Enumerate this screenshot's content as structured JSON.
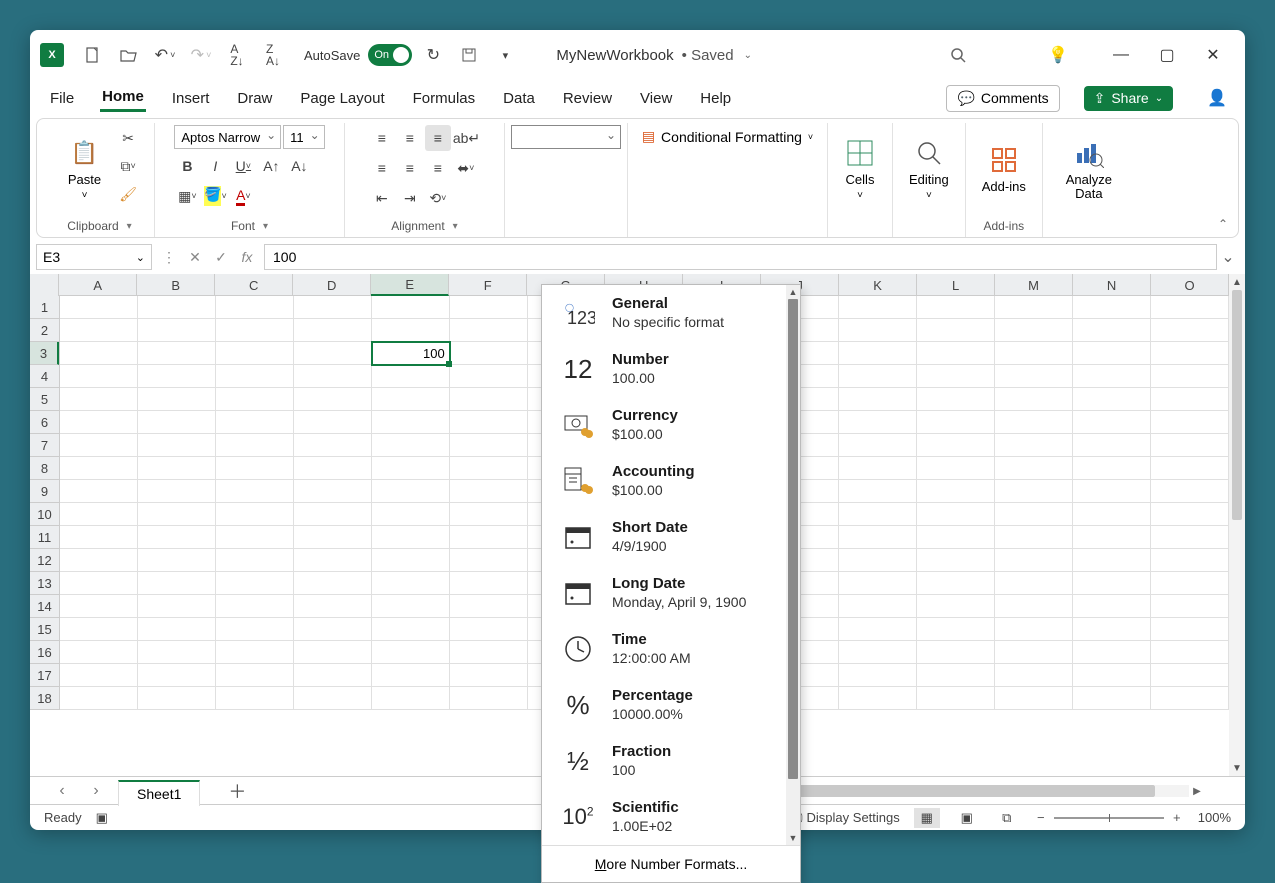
{
  "titlebar": {
    "autosave_label": "AutoSave",
    "autosave_state": "On",
    "filename": "MyNewWorkbook",
    "status": "Saved"
  },
  "tabs": {
    "file": "File",
    "home": "Home",
    "insert": "Insert",
    "draw": "Draw",
    "page_layout": "Page Layout",
    "formulas": "Formulas",
    "data": "Data",
    "review": "Review",
    "view": "View",
    "help": "Help",
    "comments": "Comments",
    "share": "Share"
  },
  "ribbon": {
    "clipboard": {
      "label": "Clipboard",
      "paste": "Paste"
    },
    "font": {
      "label": "Font",
      "name": "Aptos Narrow",
      "size": "11"
    },
    "alignment": {
      "label": "Alignment"
    },
    "conditional_formatting": "Conditional Formatting",
    "cells": "Cells",
    "editing": "Editing",
    "addins": "Add-ins",
    "addins_group": "Add-ins",
    "analyze_data": "Analyze Data"
  },
  "namebox": {
    "value": "E3"
  },
  "formula": {
    "value": "100"
  },
  "grid": {
    "columns": [
      "A",
      "B",
      "C",
      "D",
      "E",
      "F",
      "G",
      "H",
      "I",
      "J",
      "K",
      "L",
      "M",
      "N",
      "O"
    ],
    "rows": [
      1,
      2,
      3,
      4,
      5,
      6,
      7,
      8,
      9,
      10,
      11,
      12,
      13,
      14,
      15,
      16,
      17,
      18
    ],
    "selected": {
      "col": "E",
      "row": 3,
      "value": "100"
    }
  },
  "format_dropdown": {
    "items": [
      {
        "title": "General",
        "sample": "No specific format"
      },
      {
        "title": "Number",
        "sample": "100.00"
      },
      {
        "title": "Currency",
        "sample": "$100.00"
      },
      {
        "title": "Accounting",
        "sample": " $100.00"
      },
      {
        "title": "Short Date",
        "sample": "4/9/1900"
      },
      {
        "title": "Long Date",
        "sample": "Monday, April 9, 1900"
      },
      {
        "title": "Time",
        "sample": "12:00:00 AM"
      },
      {
        "title": "Percentage",
        "sample": "10000.00%"
      },
      {
        "title": "Fraction",
        "sample": "100"
      },
      {
        "title": "Scientific",
        "sample": "1.00E+02"
      }
    ],
    "footer_pre": "M",
    "footer_rest": "ore Number Formats..."
  },
  "sheet_tabs": {
    "sheet1": "Sheet1"
  },
  "statusbar": {
    "ready": "Ready",
    "display_settings": "Display Settings",
    "zoom": "100%"
  }
}
